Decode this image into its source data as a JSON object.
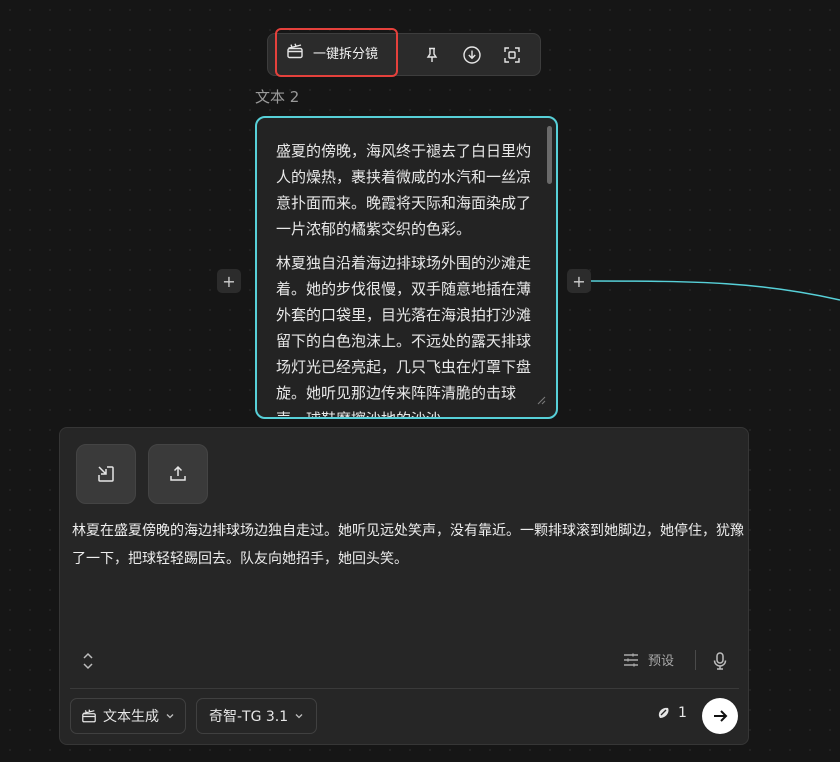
{
  "toolbar": {
    "split_label": "一键拆分镜"
  },
  "node": {
    "label": "文本 2",
    "paragraphs": [
      "盛夏的傍晚，海风终于褪去了白日里灼人的燥热，裹挟着微咸的水汽和一丝凉意扑面而来。晚霞将天际和海面染成了一片浓郁的橘紫交织的色彩。",
      "林夏独自沿着海边排球场外围的沙滩走着。她的步伐很慢，双手随意地插在薄外套的口袋里，目光落在海浪拍打沙滩留下的白色泡沫上。不远处的露天排球场灯光已经亮起，几只飞虫在灯罩下盘旋。她听见那边传来阵阵清脆的击球声，球鞋摩擦沙地的沙沙"
    ]
  },
  "panel": {
    "prompt": "林夏在盛夏傍晚的海边排球场边独自走过。她听见远处笑声，没有靠近。一颗排球滚到她脚边，她停住，犹豫了一下，把球轻轻踢回去。队友向她招手，她回头笑。",
    "preset_label": "预设",
    "mode_label": "文本生成",
    "model_label": "奇智-TG 3.1",
    "credit": "1"
  },
  "colors": {
    "accent_border": "#57d0d8",
    "highlight": "#e5413c",
    "connector": "#57d0d8"
  },
  "icons": [
    "clapperboard-icon",
    "pin-icon",
    "download-icon",
    "focus-icon",
    "plus-icon",
    "import-icon",
    "upload-icon",
    "expand-icon",
    "sliders-icon",
    "microphone-icon",
    "chevron-down-icon",
    "credit-icon",
    "arrow-right-icon"
  ]
}
